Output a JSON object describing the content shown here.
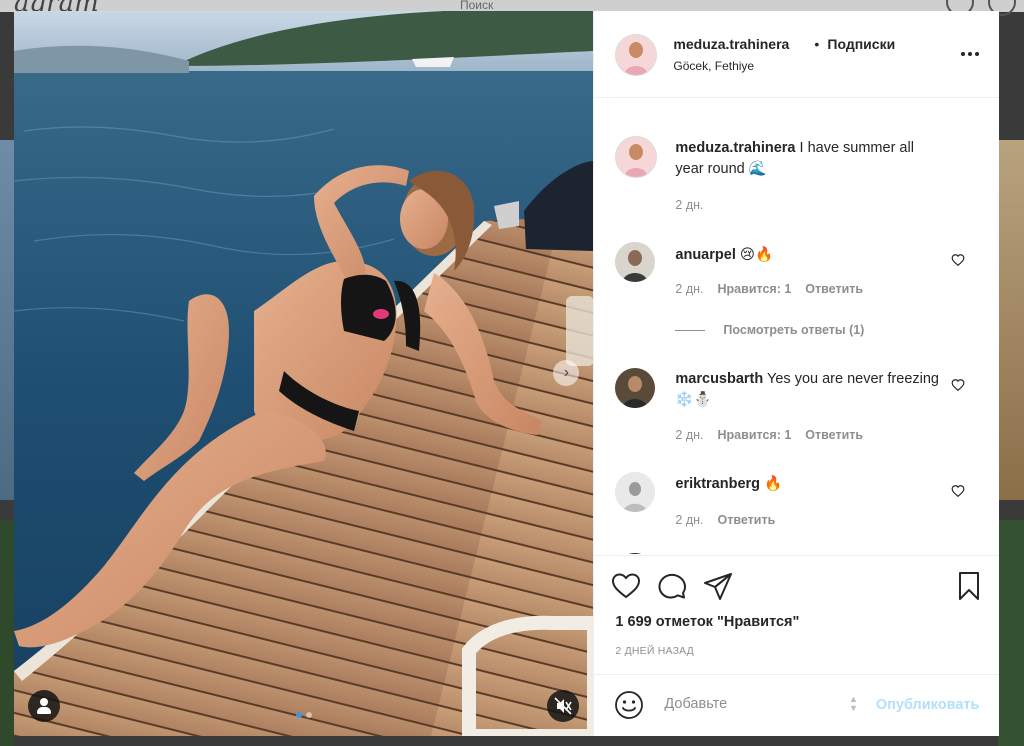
{
  "background": {
    "logo_text": "agram",
    "search_text": "Поиск"
  },
  "post": {
    "username": "meduza.trahinera",
    "separator": "•",
    "follow_label": "Подписки",
    "location": "Göcek, Fethiye",
    "caption": "I have summer all year round 🌊",
    "caption_age": "2 дн.",
    "likes_text": "1 699 отметок \"Нравится\"",
    "date_text": "2 ДНЕЙ НАЗАД",
    "media_slides": 2,
    "media_active_slide": 1
  },
  "comments": [
    {
      "username": "anuarpel",
      "text": "😢🔥",
      "age": "2 дн.",
      "likes": "Нравится: 1",
      "reply": "Ответить",
      "view_replies": "Посмотреть ответы (1)"
    },
    {
      "username": "marcusbarth",
      "text": "Yes you are never freezing ❄️⛄",
      "age": "2 дн.",
      "likes": "Нравится: 1",
      "reply": "Ответить"
    },
    {
      "username": "eriktranberg",
      "text": "🔥",
      "age": "2 дн.",
      "reply": "Ответить"
    }
  ],
  "add_comment": {
    "placeholder": "Добавьте",
    "publish_label": "Опубликовать"
  },
  "colors": {
    "text": "#262626",
    "secondary": "#8e8e8e",
    "publish_disabled": "#b2dffc",
    "border": "#efefef"
  }
}
